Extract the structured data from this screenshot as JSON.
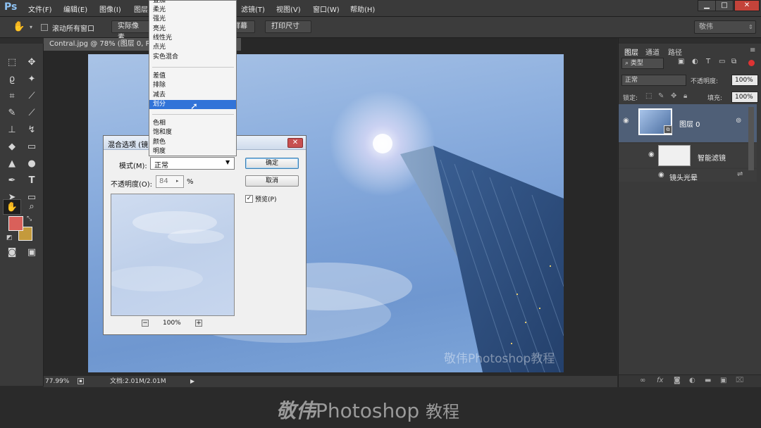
{
  "menubar": {
    "logo": "Ps",
    "items": [
      "文件(F)",
      "编辑(E)",
      "图像(I)",
      "图层",
      "滤镜(T)",
      "视图(V)",
      "窗口(W)",
      "帮助(H)"
    ],
    "window_controls": [
      "▁",
      "□",
      "✕"
    ]
  },
  "options": {
    "scroll_all": "滚动所有窗口",
    "actual_pixels": "实际像素",
    "fill_screen": "屏幕",
    "print_size": "打印尺寸",
    "workspace": "敬伟"
  },
  "doc": {
    "tab_title": "Contral.jpg @ 78% (图层 0, R",
    "zoom": "77.99%",
    "doc_size": "文档:2.01M/2.01M",
    "watermark": "敬伟Photoshop教程"
  },
  "layers_panel": {
    "tabs": [
      "图层",
      "通道",
      "路径"
    ],
    "kind": "类型",
    "blend_mode": "正常",
    "opacity_label": "不透明度:",
    "opacity_value": "100%",
    "lock_label": "锁定:",
    "fill_label": "填充:",
    "fill_value": "100%",
    "layer0_name": "图层 0",
    "smart_filters": "智能滤镜",
    "lens_flare": "镜头光晕"
  },
  "blend_dropdown": {
    "items_a": [
      "叠加",
      "柔光",
      "强光",
      "亮光",
      "线性光",
      "点光",
      "实色混合"
    ],
    "items_b": [
      "差值",
      "排除",
      "减去",
      "划分"
    ],
    "items_c": [
      "色相",
      "饱和度",
      "颜色",
      "明度"
    ],
    "selected": "划分"
  },
  "dialog": {
    "title": "混合选项 (镜",
    "mode_label": "模式(M):",
    "mode_value": "正常",
    "opacity_label": "不透明度(O):",
    "opacity_value": "84",
    "percent": "%",
    "ok": "确定",
    "cancel": "取消",
    "preview": "预览(P)",
    "zoom": "100%",
    "zoom_out": "−",
    "zoom_in": "+"
  },
  "banner": {
    "brand": "敬伟",
    "product": "Photoshop",
    "suffix": "教程"
  },
  "colors": {
    "foreground": "#d9605a",
    "background": "#c49a3c",
    "selection": "#3173d8"
  }
}
